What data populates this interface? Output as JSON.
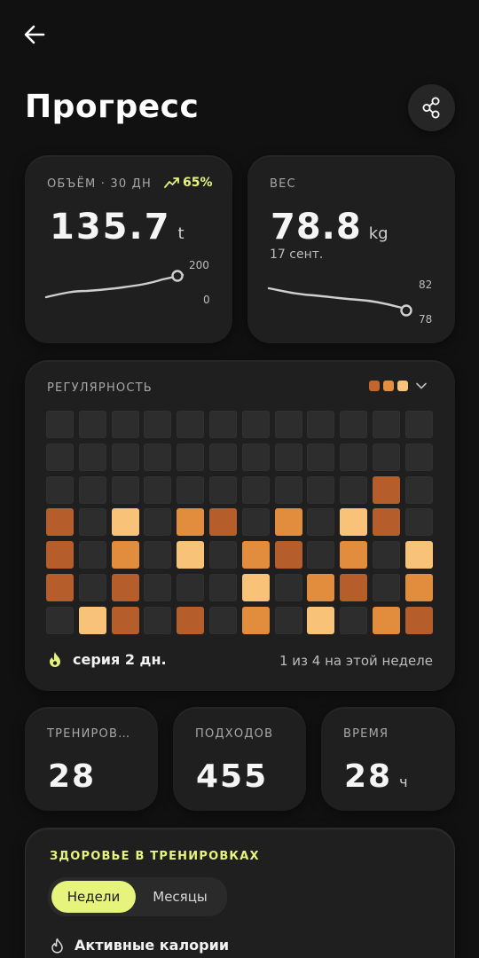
{
  "header": {
    "back_icon": "arrow-left-icon",
    "title": "Прогресс",
    "share_icon": "share-icon"
  },
  "volume": {
    "label": "ОБЪЁМ · 30 ДН",
    "trend": "65%",
    "value": "135.7",
    "unit": "t",
    "axis_max": "200",
    "axis_min": "0"
  },
  "weight": {
    "label": "ВЕС",
    "value": "78.8",
    "unit": "kg",
    "date": "17 сент.",
    "axis_max": "82",
    "axis_min": "78"
  },
  "regularity": {
    "label": "РЕГУЛЯРНОСТЬ",
    "legend_colors": [
      "#c2662e",
      "#e48f3e",
      "#f7c27a"
    ],
    "colors": {
      "empty": "#2d2d2d",
      "1": "#b55e2c",
      "2": "#e28d3e",
      "3": "#f8c378"
    },
    "grid": [
      [
        0,
        0,
        0,
        0,
        0,
        0,
        0,
        0,
        0,
        0,
        0,
        0
      ],
      [
        0,
        0,
        0,
        0,
        0,
        0,
        0,
        0,
        0,
        0,
        0,
        0
      ],
      [
        0,
        0,
        0,
        0,
        0,
        0,
        0,
        0,
        0,
        0,
        1,
        0
      ],
      [
        1,
        0,
        3,
        0,
        2,
        1,
        0,
        2,
        0,
        3,
        1,
        0
      ],
      [
        1,
        0,
        2,
        0,
        3,
        0,
        2,
        1,
        0,
        2,
        0,
        3
      ],
      [
        1,
        0,
        1,
        0,
        0,
        0,
        3,
        0,
        2,
        1,
        0,
        2
      ],
      [
        0,
        3,
        1,
        0,
        1,
        0,
        2,
        0,
        3,
        0,
        2,
        1
      ]
    ],
    "streak": "серия 2 дн.",
    "week_progress": "1 из 4 на этой неделе"
  },
  "stats": [
    {
      "label": "ТРЕНИРОВ…",
      "value": "28",
      "unit": ""
    },
    {
      "label": "ПОДХОДОВ",
      "value": "455",
      "unit": ""
    },
    {
      "label": "ВРЕМЯ",
      "value": "28",
      "unit": "ч"
    }
  ],
  "health": {
    "title": "ЗДОРОВЬЕ В ТРЕНИРОВКАХ",
    "tabs": [
      "Недели",
      "Месяцы"
    ],
    "active_tab": "Недели",
    "metric": "Активные калории"
  },
  "colors": {
    "accent": "#e6f47e",
    "background": "#111111",
    "card": "#1f1f1f"
  }
}
